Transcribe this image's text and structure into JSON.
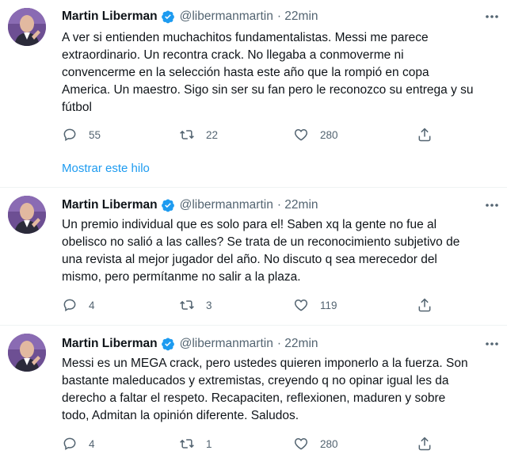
{
  "tweets": [
    {
      "name": "Martin Liberman",
      "handle": "@libermanmartin",
      "time": "· 22min",
      "text": "A ver si entienden muchachitos fundamentalistas. Messi me parece\nextraordinario. Un recontra crack. No llegaba a conmoverme ni\nconvencerme en la selección hasta este año que la rompió en copa\nAmerica. Un maestro. Sigo sin ser su fan pero le reconozco su entrega y su\nfútbol",
      "replies": "55",
      "retweets": "22",
      "likes": "280"
    },
    {
      "name": "Martin Liberman",
      "handle": "@libermanmartin",
      "time": "· 22min",
      "text": "Un premio individual que es solo para el! Saben xq la gente no fue al\nobelisco no salió a las calles? Se trata de un reconocimiento subjetivo de\nuna revista al mejor jugador del año. No discuto q sea merecedor del\nmismo, pero permítanme no salir a la plaza.",
      "replies": "4",
      "retweets": "3",
      "likes": "119"
    },
    {
      "name": "Martin Liberman",
      "handle": "@libermanmartin",
      "time": "· 22min",
      "text": "Messi es un MEGA crack, pero ustedes quieren imponerlo a la fuerza. Son\nbastante maleducados y extremistas, creyendo q no opinar igual les da\nderecho a faltar el respeto. Recapaciten, reflexionen, maduren y sobre\ntodo, Admitan la opinión diferente. Saludos.",
      "replies": "4",
      "retweets": "1",
      "likes": "280"
    }
  ],
  "show_thread": "Mostrar este hilo",
  "colors": {
    "accent": "#1d9bf0",
    "muted": "#536471",
    "text": "#0f1419"
  }
}
